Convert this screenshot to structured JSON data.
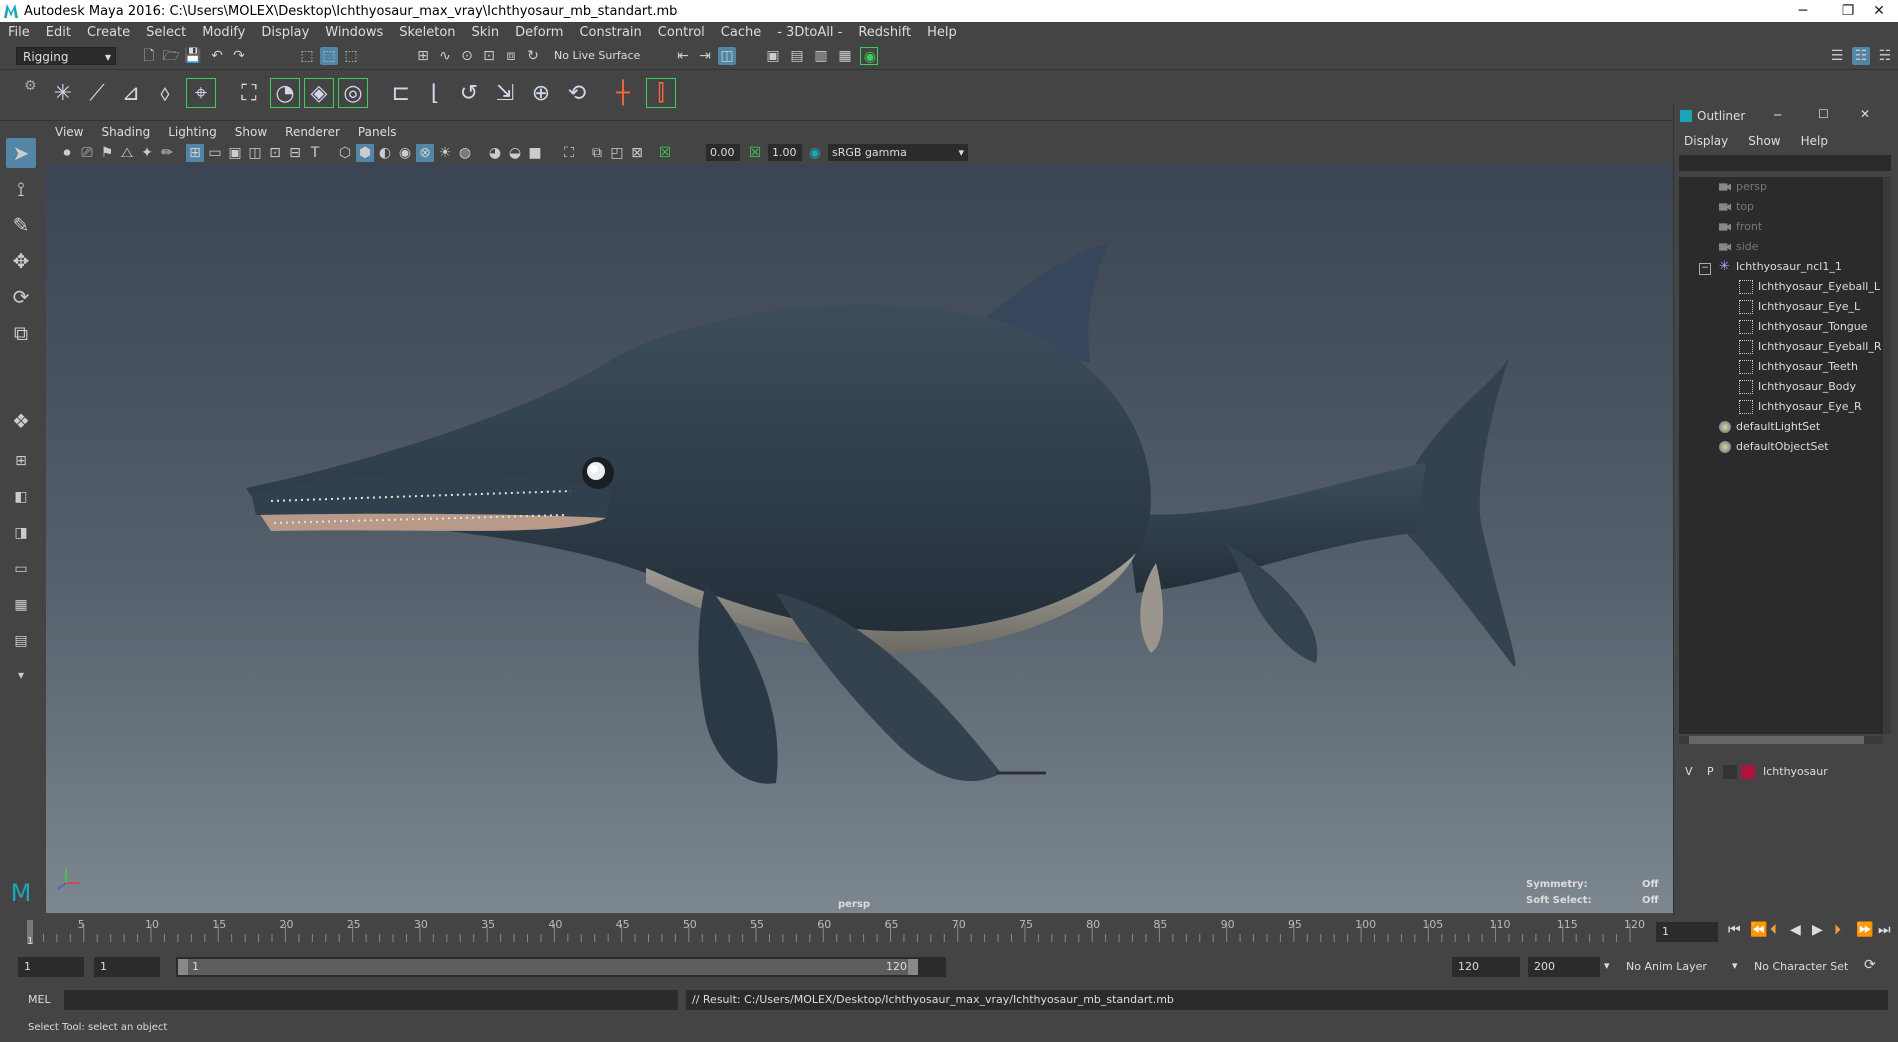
{
  "window": {
    "title": "Autodesk Maya 2016: C:\\Users\\MOLEX\\Desktop\\Ichthyosaur_max_vray\\Ichthyosaur_mb_standart.mb",
    "minimize": "─",
    "restore": "❐",
    "close": "✕"
  },
  "menubar": [
    "File",
    "Edit",
    "Create",
    "Select",
    "Modify",
    "Display",
    "Windows",
    "Skeleton",
    "Skin",
    "Deform",
    "Constrain",
    "Control",
    "Cache",
    "- 3DtoAll -",
    "Redshift",
    "Help"
  ],
  "statusline": {
    "mode": "Rigging",
    "live_surface": "No Live Surface"
  },
  "viewport": {
    "menu": [
      "View",
      "Shading",
      "Lighting",
      "Show",
      "Renderer",
      "Panels"
    ],
    "exposure": "0.00",
    "gamma": "1.00",
    "color_space": "sRGB gamma",
    "camera_label": "persp",
    "hud_symmetry_label": "Symmetry:",
    "hud_symmetry_value": "Off",
    "hud_softselect_label": "Soft Select:",
    "hud_softselect_value": "Off"
  },
  "outliner": {
    "title": "Outliner",
    "menu": [
      "Display",
      "Show",
      "Help"
    ],
    "items": [
      {
        "label": "persp",
        "type": "camera"
      },
      {
        "label": "top",
        "type": "camera"
      },
      {
        "label": "front",
        "type": "camera"
      },
      {
        "label": "side",
        "type": "camera"
      },
      {
        "label": "Ichthyosaur_ncl1_1",
        "type": "group"
      },
      {
        "label": "Ichthyosaur_Eyeball_L",
        "type": "mesh"
      },
      {
        "label": "Ichthyosaur_Eye_L",
        "type": "mesh"
      },
      {
        "label": "Ichthyosaur_Tongue",
        "type": "mesh"
      },
      {
        "label": "Ichthyosaur_Eyeball_R",
        "type": "mesh"
      },
      {
        "label": "Ichthyosaur_Teeth",
        "type": "mesh"
      },
      {
        "label": "Ichthyosaur_Body",
        "type": "mesh"
      },
      {
        "label": "Ichthyosaur_Eye_R",
        "type": "mesh"
      },
      {
        "label": "defaultLightSet",
        "type": "set"
      },
      {
        "label": "defaultObjectSet",
        "type": "set"
      }
    ],
    "layer": {
      "v": "V",
      "p": "P",
      "name": "Ichthyosaur",
      "color": "#b0143c"
    }
  },
  "timeslider": {
    "ticks": [
      1,
      5,
      10,
      15,
      20,
      25,
      30,
      35,
      40,
      45,
      50,
      55,
      60,
      65,
      70,
      75,
      80,
      85,
      90,
      95,
      100,
      105,
      110,
      115,
      120
    ],
    "labels": [
      5,
      10,
      15,
      20,
      25,
      30,
      35,
      40,
      45,
      50,
      55,
      60,
      65,
      70,
      75,
      80,
      85,
      90,
      95,
      100,
      105,
      110,
      115,
      120
    ],
    "current_start": "1",
    "current_frame": "1"
  },
  "rangeslider": {
    "start": "1",
    "anim_start": "1",
    "range_start": "1",
    "range_end": "120",
    "anim_end": "120",
    "end": "200",
    "anim_layer": "No Anim Layer",
    "character_set": "No Character Set"
  },
  "commandline": {
    "language": "MEL",
    "result": "// Result: C:/Users/MOLEX/Desktop/Ichthyosaur_max_vray/Ichthyosaur_mb_standart.mb"
  },
  "helpline": {
    "text": "Select Tool: select an object"
  },
  "colors": {
    "accent": "#5285a6",
    "selected_layer": "#b0143c",
    "shelf_highlight": "#3ccf5a"
  }
}
